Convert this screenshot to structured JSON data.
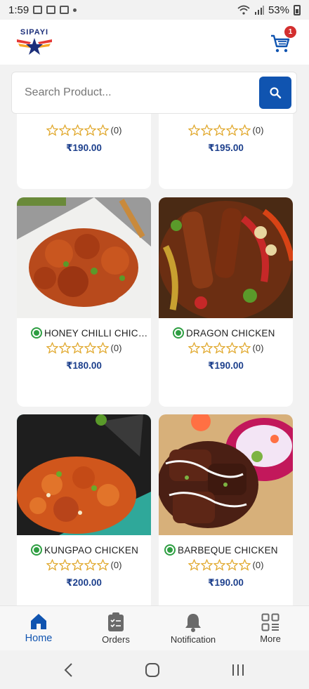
{
  "status_bar": {
    "time": "1:59",
    "battery": "53%"
  },
  "header": {
    "logo_text": "SIPAYI",
    "cart_count": "1"
  },
  "search": {
    "placeholder": "Search Product..."
  },
  "colors": {
    "accent": "#1054b0",
    "price": "#1c3f8c",
    "veg": "#2e9e42",
    "star": "#e0a72a",
    "badge": "#d32f2f"
  },
  "products": [
    {
      "name": "",
      "rating_count": "(0)",
      "price": "₹190.00"
    },
    {
      "name": "",
      "rating_count": "(0)",
      "price": "₹195.00"
    },
    {
      "name": "HONEY CHILLI CHICKEN",
      "rating_count": "(0)",
      "price": "₹180.00"
    },
    {
      "name": "DRAGON CHICKEN",
      "rating_count": "(0)",
      "price": "₹190.00"
    },
    {
      "name": "KUNGPAO CHICKEN",
      "rating_count": "(0)",
      "price": "₹200.00"
    },
    {
      "name": "BARBEQUE CHICKEN",
      "rating_count": "(0)",
      "price": "₹190.00"
    }
  ],
  "bottom_nav": [
    {
      "label": "Home",
      "icon": "home-icon",
      "active": true
    },
    {
      "label": "Orders",
      "icon": "clipboard-icon",
      "active": false
    },
    {
      "label": "Notification",
      "icon": "bell-icon",
      "active": false
    },
    {
      "label": "More",
      "icon": "grid-icon",
      "active": false
    }
  ]
}
